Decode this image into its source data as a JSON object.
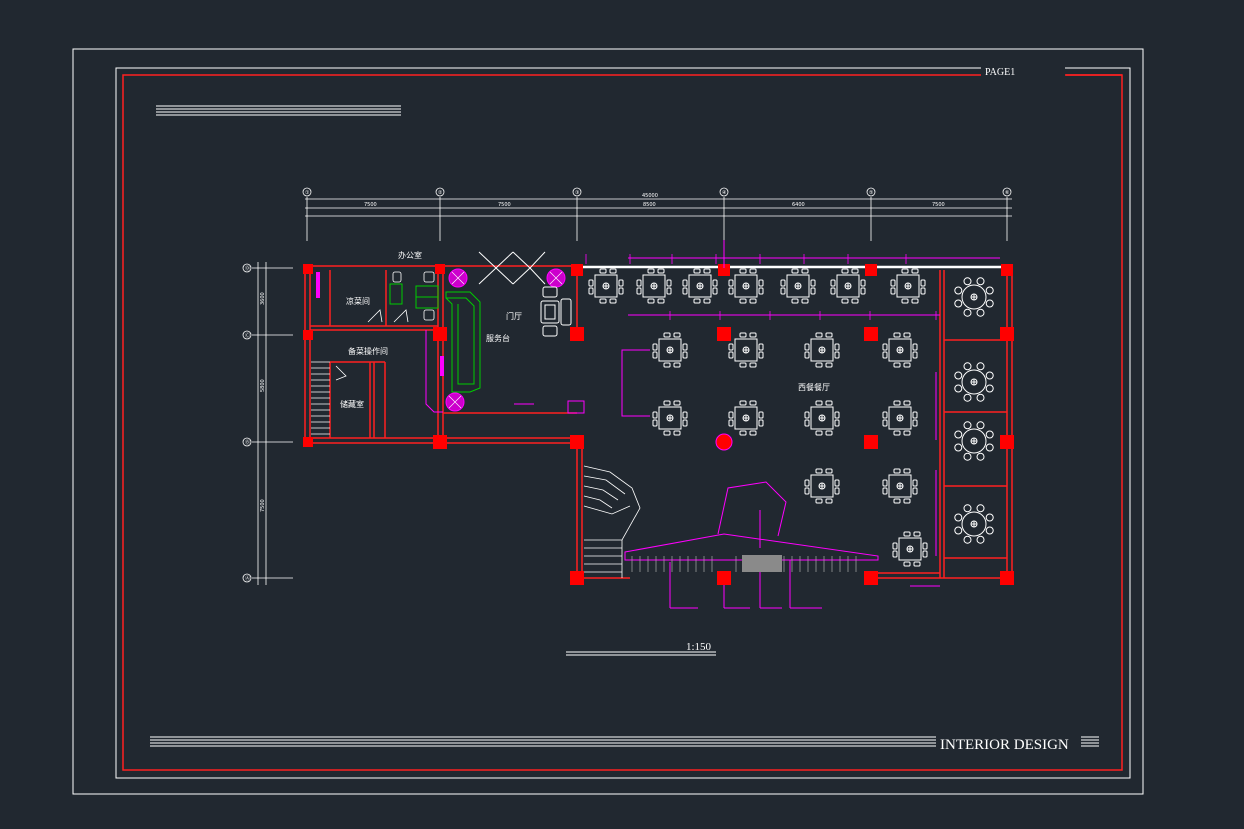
{
  "sheet": {
    "page_label": "PAGE1",
    "scale_label": "1:150",
    "footer_title": "INTERIOR DESIGN"
  },
  "grid_axes": {
    "top": [
      "①",
      "②",
      "③",
      "④",
      "⑤",
      "⑥"
    ],
    "left": [
      "Ⓓ",
      "Ⓒ",
      "Ⓑ",
      "Ⓐ"
    ]
  },
  "dimensions": {
    "top_total": "45000",
    "top_spans": [
      "7500",
      "7500",
      "8500",
      "6400",
      "7500"
    ],
    "left_spans": [
      "3600",
      "5800",
      "7500"
    ]
  },
  "rooms": {
    "office": "办公室",
    "cold_dish": "凉菜间",
    "lobby": "门厅",
    "service_counter": "服务台",
    "prep_room": "备菜操作间",
    "storage": "储藏室",
    "dining_hall": "西餐餐厅"
  },
  "colors": {
    "background": "#212830",
    "wall": "#ff2020",
    "column": "#ff0000",
    "furniture": "#ffffff",
    "annotation": "#ff00ff",
    "counter": "#00cc00"
  }
}
